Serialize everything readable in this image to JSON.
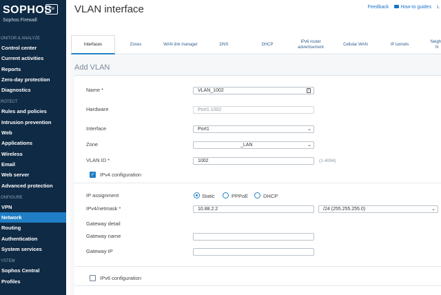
{
  "app": {
    "logo": "SOPHOS",
    "logo_sub": "Sophos Firewall",
    "badge": "Fw"
  },
  "sidebar": {
    "sections": [
      {
        "title": "ONITOR & ANALYZE",
        "items": [
          "Control center",
          "Current activities",
          "Reports",
          "Zero-day protection",
          "Diagnostics"
        ]
      },
      {
        "title": "ROTECT",
        "items": [
          "Rules and policies",
          "Intrusion prevention",
          "Web",
          "Applications",
          "Wireless",
          "Email",
          "Web server",
          "Advanced protection"
        ]
      },
      {
        "title": "ONFIGURE",
        "items": [
          "VPN",
          "Network",
          "Routing",
          "Authentication",
          "System services"
        ]
      },
      {
        "title": "YSTEM",
        "items": [
          "Sophos Central",
          "Profiles"
        ]
      }
    ],
    "active_item": "Network"
  },
  "header": {
    "title": "VLAN interface",
    "feedback": "Feedback",
    "howto": "How-to guides",
    "extra": "L"
  },
  "tabs": [
    "Interfaces",
    "Zones",
    "WAN link manager",
    "DNS",
    "DHCP",
    "IPv6 router advertisement",
    "Cellular WAN",
    "IP tunnels",
    "Neighbors (ARP-NDP)"
  ],
  "tabs_display": {
    "ipv6_line1": "IPv6 router",
    "ipv6_line2": "advertisement",
    "neighbors_line1": "Neighb",
    "neighbors_line2": "N"
  },
  "form": {
    "section_title": "Add VLAN",
    "name_label": "Name *",
    "name_value": "VLAN_1002",
    "hardware_label": "Hardware",
    "hardware_value": "Port1.1002",
    "interface_label": "Interface",
    "interface_value": "Port1",
    "zone_label": "Zone",
    "zone_value": "_LAN",
    "vlan_id_label": "VLAN ID *",
    "vlan_id_value": "1002",
    "vlan_id_hint": "(1-4094)",
    "ipv4_config_label": "IPv4 configuration",
    "ipv4_config_checked": true,
    "ip_assignment_label": "IP assignment",
    "ip_assignment_options": [
      "Static",
      "PPPoE",
      "DHCP"
    ],
    "ip_assignment_selected": "Static",
    "ipv4_netmask_label": "IPv4/netmask *",
    "ipv4_value": "10.88.2.2",
    "netmask_value": "/24 (255.255.255.0)",
    "gateway_detail_label": "Gateway detail",
    "gateway_name_label": "Gateway name",
    "gateway_name_value": "",
    "gateway_ip_label": "Gateway IP",
    "gateway_ip_value": "",
    "ipv6_config_label": "IPv6 configuration",
    "ipv6_config_checked": false
  },
  "colors": {
    "sidebar_bg": "#0f2a44",
    "active_blue": "#1f7ec5",
    "link_blue": "#1a73c8"
  }
}
